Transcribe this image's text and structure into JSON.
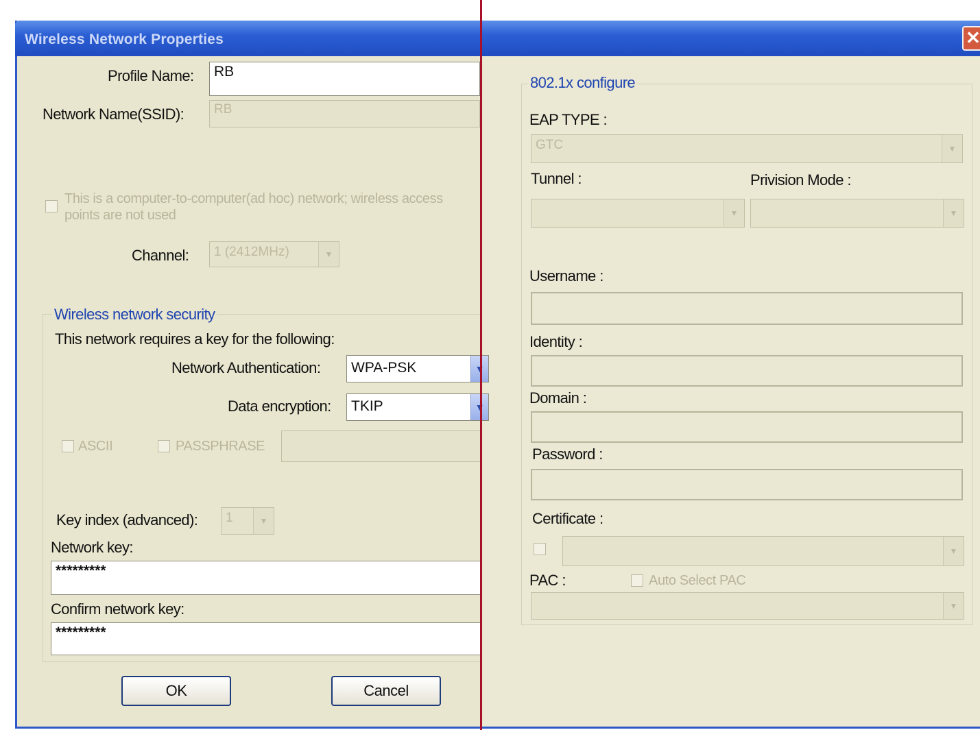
{
  "window": {
    "title": "Wireless Network Properties",
    "close_glyph": "✕"
  },
  "profile": {
    "profile_name_label": "Profile Name:",
    "profile_name_value": "RB",
    "ssid_label": "Network Name(SSID):",
    "ssid_value": "RB"
  },
  "adhoc": {
    "checkbox_label": "This is a computer-to-computer(ad hoc) network; wireless access points are not used",
    "channel_label": "Channel:",
    "channel_value": "1  (2412MHz)"
  },
  "security": {
    "group_title": "Wireless network security",
    "requires_text": "This network requires a key for the following:",
    "auth_label": "Network Authentication:",
    "auth_value": "WPA-PSK",
    "encryption_label": "Data encryption:",
    "encryption_value": "TKIP",
    "ascii_label": "ASCII",
    "passphrase_label": "PASSPHRASE",
    "key_index_label": "Key index (advanced):",
    "key_index_value": "1",
    "network_key_label": "Network key:",
    "network_key_value": "*********",
    "confirm_key_label": "Confirm network key:",
    "confirm_key_value": "*********"
  },
  "buttons": {
    "ok": "OK",
    "cancel": "Cancel"
  },
  "eap": {
    "group_title": "802.1x configure",
    "eap_type_label": "EAP TYPE :",
    "eap_type_value": "GTC",
    "tunnel_label": "Tunnel :",
    "provision_label": "Privision Mode :",
    "username_label": "Username :",
    "identity_label": "Identity :",
    "domain_label": "Domain :",
    "password_label": "Password :",
    "certificate_label": "Certificate :",
    "pac_label": "PAC :",
    "auto_pac_label": "Auto Select PAC"
  },
  "icons": {
    "dropdown": "chevron-down-icon",
    "close": "close-icon"
  }
}
